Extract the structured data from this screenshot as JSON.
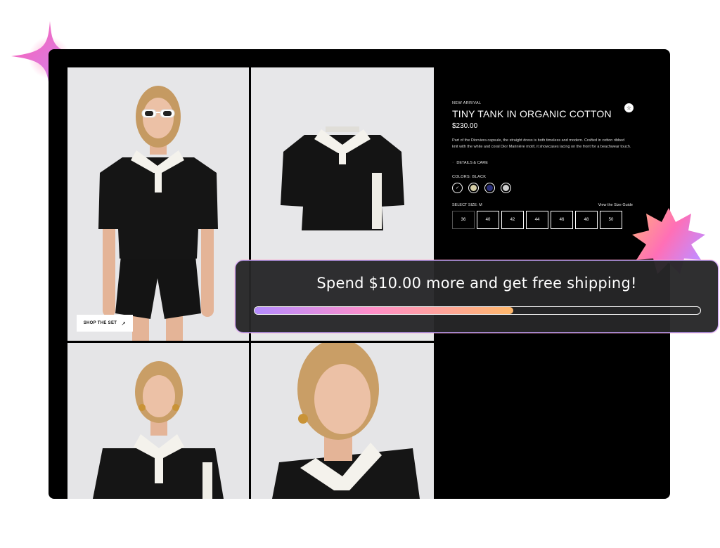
{
  "product": {
    "badge": "NEW ARRIVAL",
    "title": "TINY TANK IN ORGANIC COTTON",
    "price": "$230.00",
    "description": "Part of the Diorviera capsule, the straight dress is both timeless and modern. Crafted in cotton ribbed knit with the white and coral Dior Marinière motif, it showcases lacing on the front for a beachwear touch.",
    "details_label": "DETAILS & CARE",
    "colors_label": "COLORS: BLACK",
    "colors": [
      "#000000",
      "#d6cfa6",
      "#2a2f7a",
      "#cfcfcf"
    ],
    "size_label": "SELECT SIZE: M",
    "size_guide": "View the Size Guide",
    "sizes": [
      "36",
      "40",
      "42",
      "44",
      "46",
      "48",
      "50"
    ]
  },
  "gallery": {
    "shop_the_set": "SHOP THE SET",
    "shop_arrow": "↗"
  },
  "shipping_toast": {
    "message": "Spend $10.00 more and get free shipping!",
    "progress_percent": 58
  },
  "icons": {
    "wishlist": "star-icon",
    "arrow": "arrow-up-right-icon",
    "check": "check-icon"
  },
  "colors": {
    "card_bg": "#000000",
    "accent_purple": "#b48cff",
    "accent_pink": "#ff8ec9",
    "accent_orange": "#ffb86b"
  }
}
